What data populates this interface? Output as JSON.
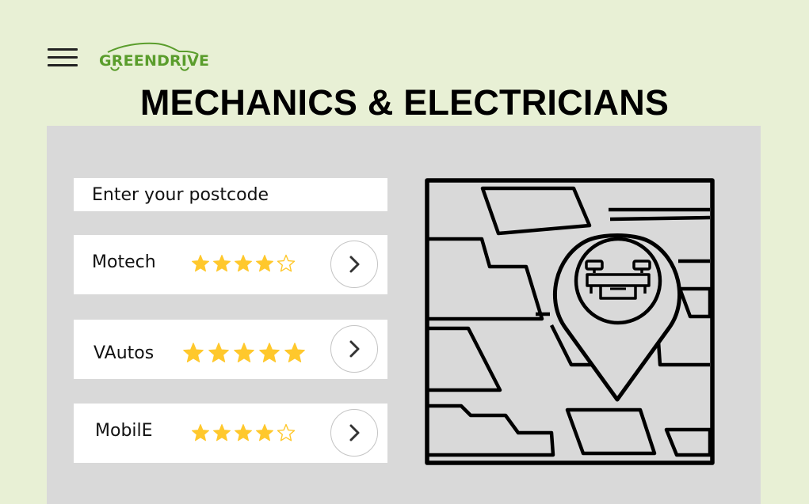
{
  "header": {
    "menu_icon": "hamburger-menu-icon",
    "logo_text": "GREENDRIVE",
    "logo_color": "#5a9d2c"
  },
  "page_title": "MECHANICS & ELECTRICIANS",
  "search": {
    "postcode_placeholder": "Enter your postcode"
  },
  "providers": [
    {
      "name": "Motech",
      "rating": 4,
      "max_rating": 5,
      "action_icon": "chevron-right-icon"
    },
    {
      "name": "VAutos",
      "rating": 5,
      "max_rating": 5,
      "action_icon": "chevron-right-icon"
    },
    {
      "name": "MobilE",
      "rating": 4,
      "max_rating": 5,
      "action_icon": "chevron-right-icon"
    }
  ],
  "map": {
    "icon": "map-location-pin-icon",
    "pin_badge_icon": "robot-icon"
  },
  "colors": {
    "background": "#e8f0d5",
    "panel": "#d9d9d9",
    "star": "#ffc82c",
    "text": "#111111"
  }
}
